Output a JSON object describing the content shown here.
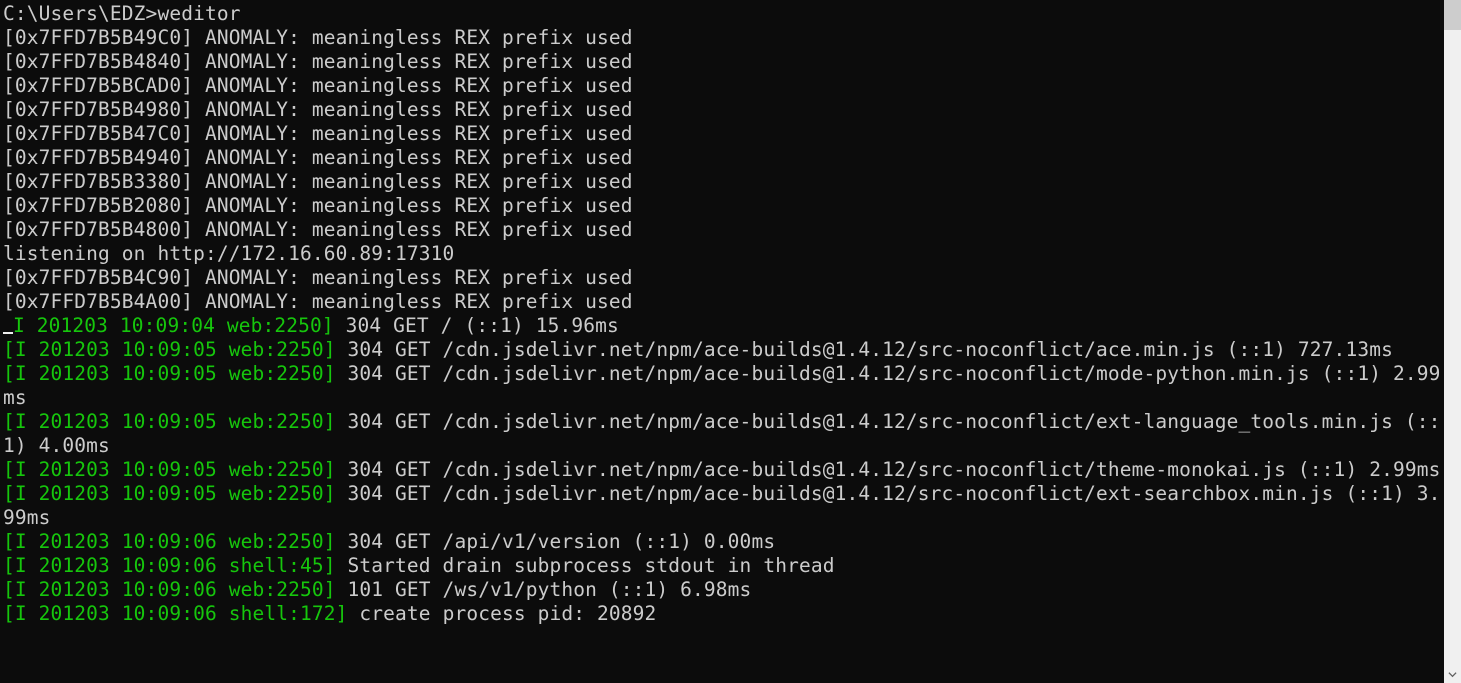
{
  "prompt": {
    "path": "C:\\Users\\EDZ>",
    "command": "weditor"
  },
  "anomaly_lines": [
    "[0x7FFD7B5B49C0] ANOMALY: meaningless REX prefix used",
    "[0x7FFD7B5B4840] ANOMALY: meaningless REX prefix used",
    "[0x7FFD7B5BCAD0] ANOMALY: meaningless REX prefix used",
    "[0x7FFD7B5B4980] ANOMALY: meaningless REX prefix used",
    "[0x7FFD7B5B47C0] ANOMALY: meaningless REX prefix used",
    "[0x7FFD7B5B4940] ANOMALY: meaningless REX prefix used",
    "[0x7FFD7B5B3380] ANOMALY: meaningless REX prefix used",
    "[0x7FFD7B5B2080] ANOMALY: meaningless REX prefix used",
    "[0x7FFD7B5B4800] ANOMALY: meaningless REX prefix used"
  ],
  "listening_line": "listening on http://172.16.60.89:17310",
  "anomaly_lines_after": [
    "[0x7FFD7B5B4C90] ANOMALY: meaningless REX prefix used",
    "[0x7FFD7B5B4A00] ANOMALY: meaningless REX prefix used"
  ],
  "log_entries": [
    {
      "prefix": "[I 201203 10:09:04 web:2250]",
      "message": " 304 GET / (::1) 15.96ms",
      "cursor": true
    },
    {
      "prefix": "[I 201203 10:09:05 web:2250]",
      "message": " 304 GET /cdn.jsdelivr.net/npm/ace-builds@1.4.12/src-noconflict/ace.min.js (::1) 727.13ms"
    },
    {
      "prefix": "[I 201203 10:09:05 web:2250]",
      "message": " 304 GET /cdn.jsdelivr.net/npm/ace-builds@1.4.12/src-noconflict/mode-python.min.js (::1) 2.99ms"
    },
    {
      "prefix": "[I 201203 10:09:05 web:2250]",
      "message": " 304 GET /cdn.jsdelivr.net/npm/ace-builds@1.4.12/src-noconflict/ext-language_tools.min.js (::1) 4.00ms"
    },
    {
      "prefix": "[I 201203 10:09:05 web:2250]",
      "message": " 304 GET /cdn.jsdelivr.net/npm/ace-builds@1.4.12/src-noconflict/theme-monokai.js (::1) 2.99ms"
    },
    {
      "prefix": "[I 201203 10:09:05 web:2250]",
      "message": " 304 GET /cdn.jsdelivr.net/npm/ace-builds@1.4.12/src-noconflict/ext-searchbox.min.js (::1) 3.99ms"
    },
    {
      "prefix": "[I 201203 10:09:06 web:2250]",
      "message": " 304 GET /api/v1/version (::1) 0.00ms"
    },
    {
      "prefix": "[I 201203 10:09:06 shell:45]",
      "message": " Started drain subprocess stdout in thread"
    },
    {
      "prefix": "[I 201203 10:09:06 web:2250]",
      "message": " 101 GET /ws/v1/python (::1) 6.98ms"
    },
    {
      "prefix": "[I 201203 10:09:06 shell:172]",
      "message": " create process pid: 20892"
    }
  ],
  "scrollbar": {
    "arrow_down": "⌄"
  }
}
